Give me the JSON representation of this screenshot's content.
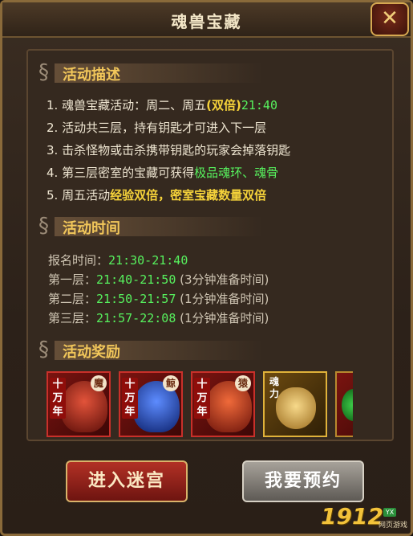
{
  "window": {
    "title": "魂兽宝藏",
    "close_glyph": "✕"
  },
  "sections": {
    "desc": {
      "label": "活动描述"
    },
    "time": {
      "label": "活动时间"
    },
    "reward": {
      "label": "活动奖励"
    }
  },
  "description": {
    "l1": {
      "num": "1.",
      "text": "魂兽宝藏活动：周二、周五",
      "paren_open": "(",
      "bold": "双倍",
      "paren_close": ")",
      "time": "21:40"
    },
    "l2": {
      "num": "2.",
      "text": "活动共三层，持有钥匙才可进入下一层"
    },
    "l3": {
      "num": "3.",
      "text": "击杀怪物或击杀携带钥匙的玩家会掉落钥匙"
    },
    "l4": {
      "num": "4.",
      "text": "第三层密室的宝藏可获得",
      "green": "极品魂环、魂骨"
    },
    "l5": {
      "num": "5.",
      "text_a": "周五活动",
      "bold_a": "经验双倍",
      "text_b": "，",
      "bold_b": "密室宝藏数量双倍"
    }
  },
  "schedule": {
    "signup": {
      "label": "报名时间：",
      "time": "21:30-21:40"
    },
    "floor1": {
      "label": "第一层：",
      "time": "21:40-21:50",
      "note": "(3分钟准备时间)"
    },
    "floor2": {
      "label": "第二层：",
      "time": "21:50-21:57",
      "note": "(1分钟准备时间)"
    },
    "floor3": {
      "label": "第三层：",
      "time": "21:57-22:08",
      "note": "(1分钟准备时间)"
    }
  },
  "rewards": [
    {
      "tag": "十万年",
      "badge": "魔"
    },
    {
      "tag": "十万年",
      "badge": "鲸"
    },
    {
      "tag": "十万年",
      "badge": "猿"
    },
    {
      "tag": "魂力"
    }
  ],
  "buttons": {
    "enter": "进入迷宫",
    "reserve": "我要预约"
  },
  "logo": {
    "number": "1912",
    "badge": "YX",
    "subtitle": "网页游戏"
  },
  "colors": {
    "accent_yellow": "#f5d23a",
    "time_green": "#57f25e",
    "section_gold": "#f2c75a"
  }
}
